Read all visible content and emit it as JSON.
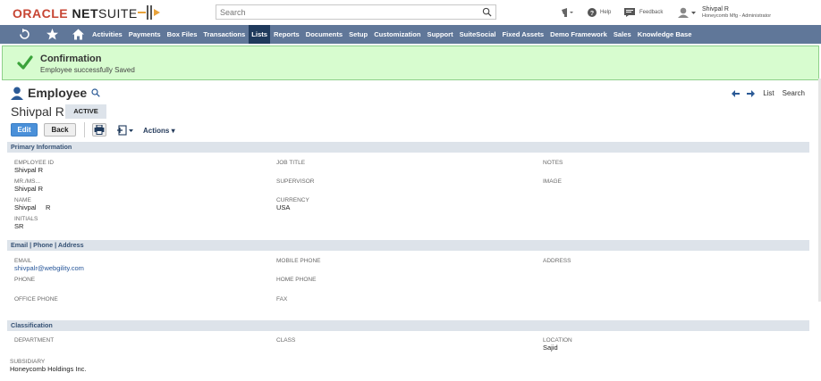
{
  "header": {
    "logo": {
      "oracle": "ORACLE",
      "net": "NET",
      "suite": "SUITE"
    },
    "search_placeholder": "Search",
    "help_label": "Help",
    "feedback_label": "Feedback",
    "user_name": "Shivpal R",
    "user_role": "Honeycomb Mfg - Administrator"
  },
  "nav": {
    "items": [
      "Activities",
      "Payments",
      "Box Files",
      "Transactions",
      "Lists",
      "Reports",
      "Documents",
      "Setup",
      "Customization",
      "Support",
      "SuiteSocial",
      "Fixed Assets",
      "Demo Framework",
      "Sales",
      "Knowledge Base"
    ],
    "active": "Lists"
  },
  "confirmation": {
    "title": "Confirmation",
    "message": "Employee successfully Saved"
  },
  "record": {
    "type": "Employee",
    "name": "Shivpal R",
    "status": "ACTIVE",
    "list_link": "List",
    "search_link": "Search"
  },
  "buttons": {
    "edit": "Edit",
    "back": "Back",
    "actions": "Actions"
  },
  "sections": {
    "primary": {
      "title": "Primary Information",
      "employee_id": {
        "label": "EMPLOYEE ID",
        "value": "Shivpal R"
      },
      "mr_ms": {
        "label": "MR./MS...",
        "value": "Shivpal R"
      },
      "name": {
        "label": "NAME",
        "value": "Shivpal     R"
      },
      "initials": {
        "label": "INITIALS",
        "value": "SR"
      },
      "job_title": {
        "label": "JOB TITLE"
      },
      "supervisor": {
        "label": "SUPERVISOR"
      },
      "currency": {
        "label": "CURRENCY",
        "value": "USA"
      },
      "notes": {
        "label": "NOTES"
      },
      "image": {
        "label": "IMAGE"
      }
    },
    "contact": {
      "title": "Email | Phone | Address",
      "email": {
        "label": "EMAIL",
        "value": "shivpalr@webgility.com"
      },
      "phone": {
        "label": "PHONE"
      },
      "office_phone": {
        "label": "OFFICE PHONE"
      },
      "mobile_phone": {
        "label": "MOBILE PHONE"
      },
      "home_phone": {
        "label": "HOME PHONE"
      },
      "fax": {
        "label": "FAX"
      },
      "address": {
        "label": "ADDRESS"
      }
    },
    "classification": {
      "title": "Classification",
      "department": {
        "label": "DEPARTMENT"
      },
      "class": {
        "label": "CLASS"
      },
      "location": {
        "label": "LOCATION",
        "value": "Sajid"
      },
      "subsidiary": {
        "label": "SUBSIDIARY",
        "value": "Honeycomb Holdings Inc."
      }
    }
  },
  "colors": {
    "nav_bg": "#607799",
    "nav_active": "#1f3a5c",
    "confirm_bg": "#d7fccf",
    "edit_button": "#4a90d9",
    "section_header": "#dde3ea"
  }
}
